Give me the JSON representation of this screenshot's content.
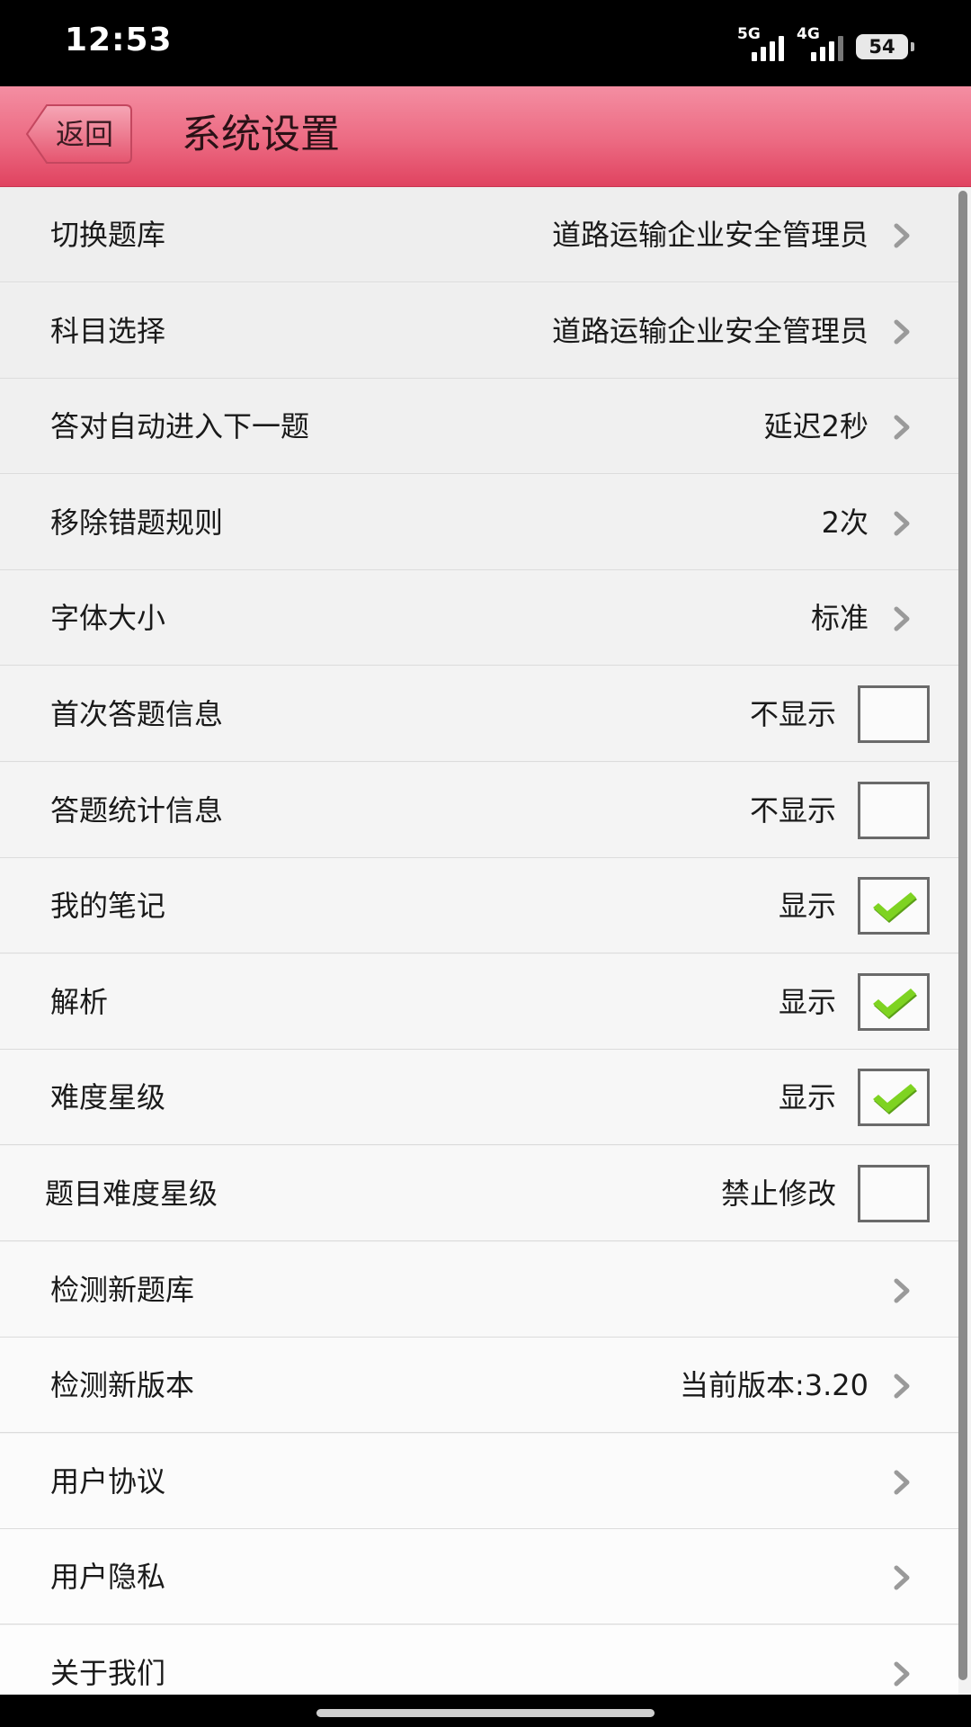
{
  "status_bar": {
    "time": "12:53",
    "network1": "5G",
    "network2": "4G",
    "battery": "54"
  },
  "header": {
    "back_label": "返回",
    "title": "系统设置"
  },
  "settings": [
    {
      "label": "切换题库",
      "value": "道路运输企业安全管理员",
      "control": "chevron"
    },
    {
      "label": "科目选择",
      "value": "道路运输企业安全管理员",
      "control": "chevron"
    },
    {
      "label": "答对自动进入下一题",
      "value": "延迟2秒",
      "control": "chevron"
    },
    {
      "label": "移除错题规则",
      "value": "2次",
      "control": "chevron"
    },
    {
      "label": "字体大小",
      "value": "标准",
      "control": "chevron"
    },
    {
      "label": "首次答题信息",
      "value": "不显示",
      "control": "checkbox",
      "checked": false
    },
    {
      "label": "答题统计信息",
      "value": "不显示",
      "control": "checkbox",
      "checked": false
    },
    {
      "label": "我的笔记",
      "value": "显示",
      "control": "checkbox",
      "checked": true
    },
    {
      "label": "解析",
      "value": "显示",
      "control": "checkbox",
      "checked": true
    },
    {
      "label": "难度星级",
      "value": "显示",
      "control": "checkbox",
      "checked": true
    },
    {
      "label": "题目难度星级",
      "value": "禁止修改",
      "control": "checkbox",
      "checked": false
    },
    {
      "label": "检测新题库",
      "value": "",
      "control": "chevron"
    },
    {
      "label": "检测新版本",
      "value": "当前版本:3.20",
      "control": "chevron"
    },
    {
      "label": "用户协议",
      "value": "",
      "control": "chevron"
    },
    {
      "label": "用户隐私",
      "value": "",
      "control": "chevron"
    },
    {
      "label": "关于我们",
      "value": "",
      "control": "chevron"
    }
  ],
  "colors": {
    "header_top": "#f48ea2",
    "header_bottom": "#e04360",
    "check_green": "#7ed321"
  }
}
